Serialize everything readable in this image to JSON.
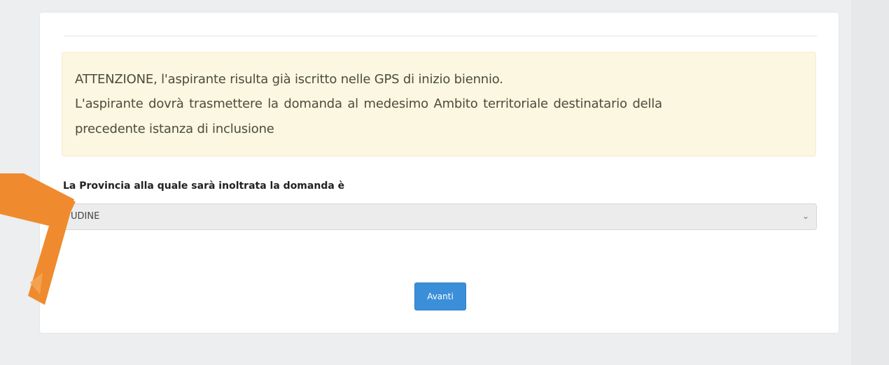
{
  "alert": {
    "line1": "ATTENZIONE, l'aspirante risulta già iscritto nelle GPS di inizio biennio.",
    "line2": "L'aspirante dovrà trasmettere la domanda al medesimo Ambito territoriale destinatario della",
    "line3": "precedente istanza di inclusione"
  },
  "form": {
    "province_label": "La Provincia alla quale sarà inoltrata la domanda è",
    "province_value": "UDINE",
    "next_button_label": "Avanti"
  },
  "colors": {
    "alert_background": "#fbf7e1",
    "button": "#3b8fd8",
    "arrow": "#ef8b2e"
  },
  "icons": {
    "dropdown": "chevron-down-icon",
    "annotation": "orange-arrow-icon"
  }
}
